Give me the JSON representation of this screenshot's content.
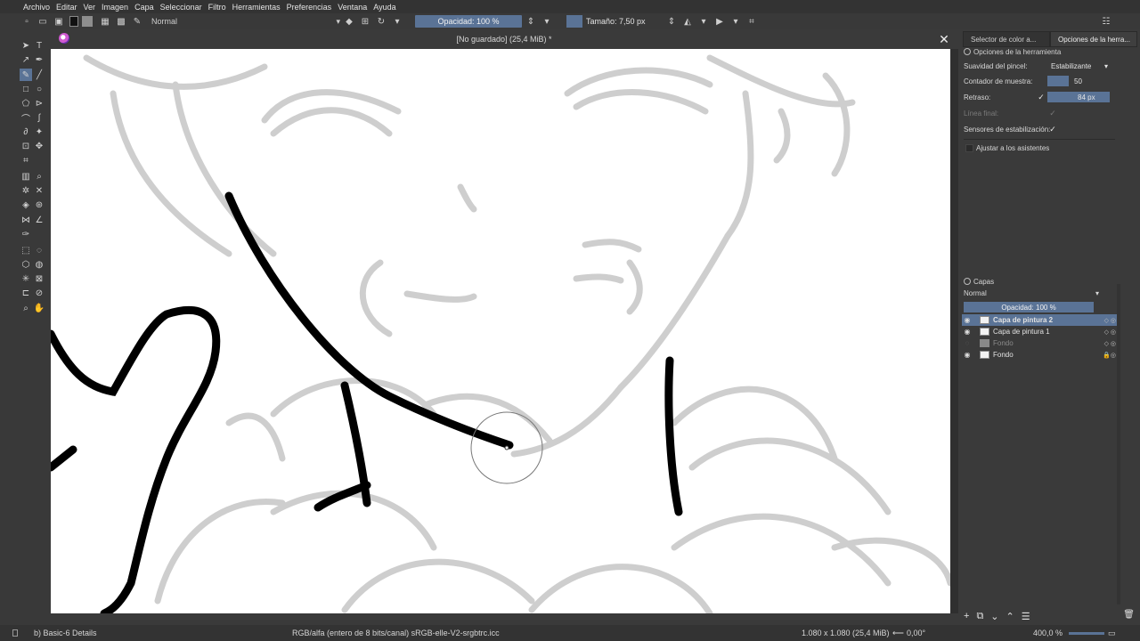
{
  "menu": [
    "Archivo",
    "Editar",
    "Ver",
    "Imagen",
    "Capa",
    "Seleccionar",
    "Filtro",
    "Herramientas",
    "Preferencias",
    "Ventana",
    "Ayuda"
  ],
  "toolbar": {
    "blend_mode": "Normal",
    "opacity": "Opacidad: 100 %",
    "size": "Tamaño: 7,50 px"
  },
  "document": {
    "title": "[No guardado]  (25,4 MiB) *"
  },
  "dock": {
    "tabs": [
      "Selector de color a...",
      "Opciones de la herra..."
    ],
    "tool_options_title": "Opciones de la herramienta",
    "rows": {
      "smoothing_label": "Suavidad del pincel:",
      "smoothing_value": "Estabilizante",
      "sample_label": "Contador de muestra:",
      "sample_value": "50",
      "delay_label": "Retraso:",
      "delay_value": "84 px",
      "finish_label": "Línea final:",
      "sensors_label": "Sensores de estabilización:",
      "assistants_label": "Ajustar a los asistentes"
    },
    "layers": {
      "title": "Capas",
      "blend": "Normal",
      "opacity": "Opacidad:  100 %",
      "items": [
        {
          "name": "Capa de pintura 2",
          "active": true,
          "visible": true
        },
        {
          "name": "Capa de pintura 1",
          "active": false,
          "visible": true
        },
        {
          "name": "Fondo",
          "active": false,
          "visible": false
        },
        {
          "name": "Fondo",
          "active": false,
          "visible": true
        }
      ]
    }
  },
  "status": {
    "brush": "b) Basic-6 Details",
    "color_space": "RGB/alfa (entero de 8 bits/canal)  sRGB-elle-V2-srgbtrc.icc",
    "dimensions": "1.080 x 1.080 (25,4 MiB)",
    "rotation": "0,00°",
    "zoom": "400,0 %"
  }
}
